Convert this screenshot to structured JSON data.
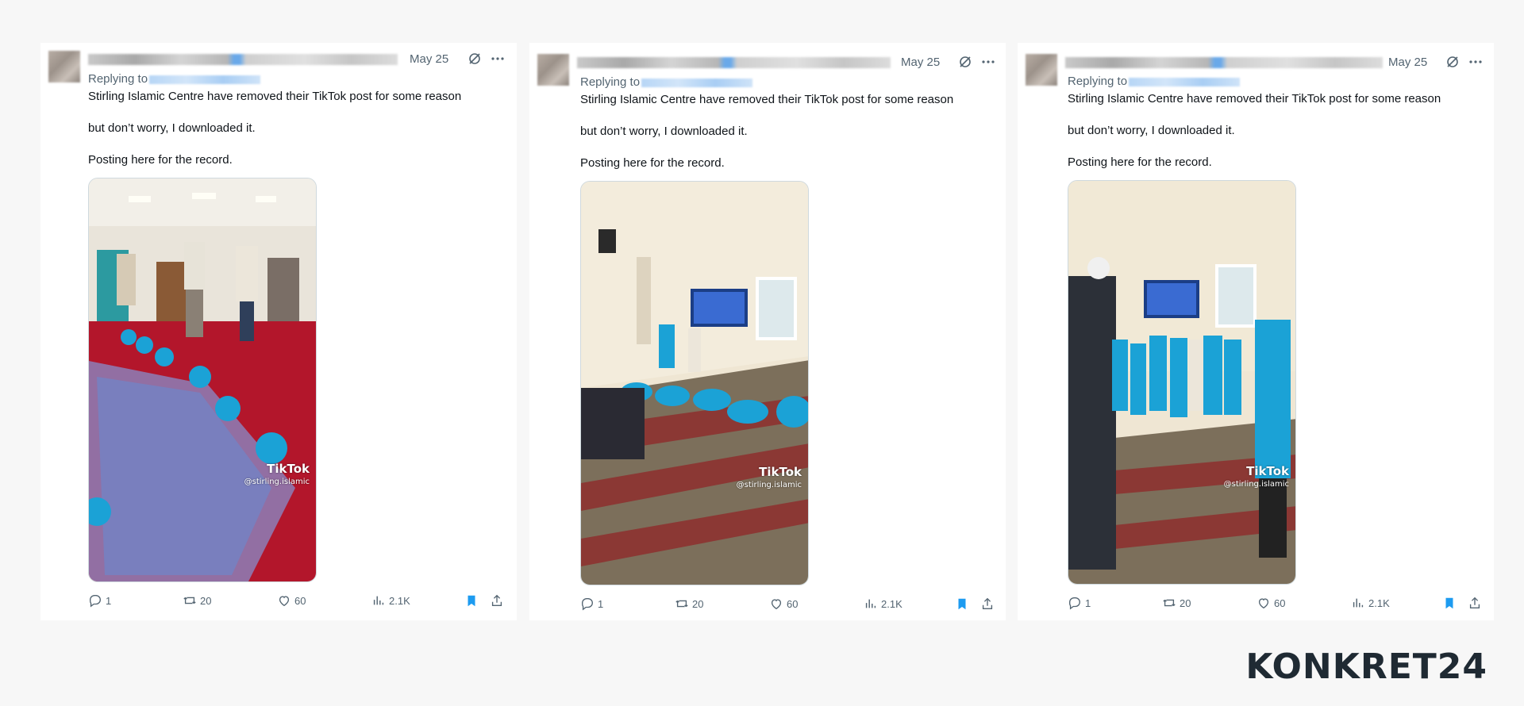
{
  "tweets": [
    {
      "date": "May 25",
      "replying_label": "Replying to",
      "text_lines": [
        "Stirling Islamic Centre have removed their TikTok post for some reason",
        "but don’t worry, I downloaded it.",
        "Posting here for the record."
      ],
      "tiktok_logo": "TikTok",
      "tiktok_handle": "@stirling.islamic",
      "stats": {
        "replies": "1",
        "reposts": "20",
        "likes": "60",
        "views": "2.1K"
      }
    },
    {
      "date": "May 25",
      "replying_label": "Replying to",
      "text_lines": [
        "Stirling Islamic Centre have removed their TikTok post for some reason",
        "but don’t worry, I downloaded it.",
        "Posting here for the record."
      ],
      "tiktok_logo": "TikTok",
      "tiktok_handle": "@stirling.islamic",
      "stats": {
        "replies": "1",
        "reposts": "20",
        "likes": "60",
        "views": "2.1K"
      }
    },
    {
      "date": "May 25",
      "replying_label": "Replying to",
      "text_lines": [
        "Stirling Islamic Centre have removed their TikTok post for some reason",
        "but don’t worry, I downloaded it.",
        "Posting here for the record."
      ],
      "tiktok_logo": "TikTok",
      "tiktok_handle": "@stirling.islamic",
      "stats": {
        "replies": "1",
        "reposts": "20",
        "likes": "60",
        "views": "2.1K"
      }
    }
  ],
  "colors": {
    "accent": "#1d9bf0",
    "muted": "#536471",
    "text": "#0f1419",
    "logo": "#1f2a33"
  },
  "icons": [
    "grok-icon",
    "more-icon",
    "reply-icon",
    "repost-icon",
    "like-icon",
    "views-icon",
    "bookmark-icon",
    "share-icon"
  ],
  "watermark": {
    "text": "KONKRET24"
  }
}
